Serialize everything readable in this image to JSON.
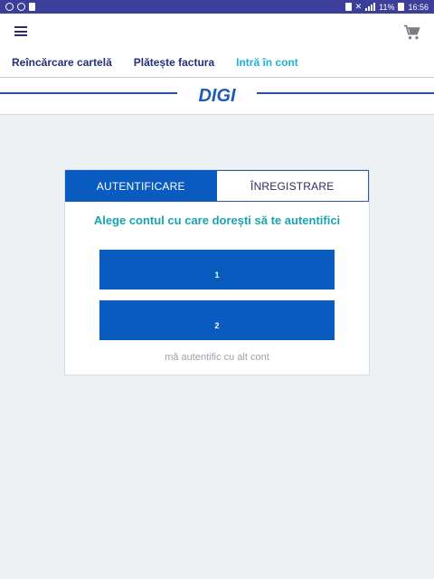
{
  "status_bar": {
    "battery_text": "11%",
    "time": "16:56"
  },
  "nav": {
    "items": [
      {
        "label": "Reîncărcare cartelă"
      },
      {
        "label": "Plătește factura"
      },
      {
        "label": "Intră în cont"
      }
    ],
    "active_index": 2
  },
  "brand": {
    "logo_text": "DIGI",
    "accent_color": "#0a5bbf",
    "nav_active_color": "#1eb2d6"
  },
  "auth": {
    "tabs": [
      {
        "label": "AUTENTIFICARE"
      },
      {
        "label": "ÎNREGISTRARE"
      }
    ],
    "title": "Alege contul cu care dorești să te autentifici",
    "accounts": [
      {
        "label": "1"
      },
      {
        "label": "2"
      }
    ],
    "other_account": "mă autentific cu alt cont"
  }
}
